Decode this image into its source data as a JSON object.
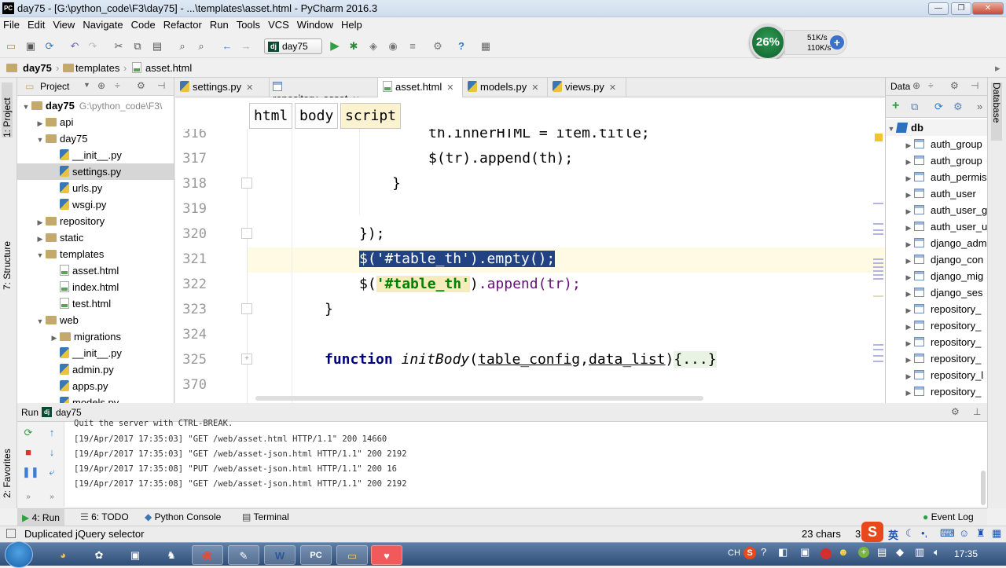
{
  "window": {
    "title": "day75 - [G:\\python_code\\F3\\day75] - ...\\templates\\asset.html - PyCharm 2016.3",
    "logo": "PC"
  },
  "menu": [
    "File",
    "Edit",
    "View",
    "Navigate",
    "Code",
    "Refactor",
    "Run",
    "Tools",
    "VCS",
    "Window",
    "Help"
  ],
  "toolbar": {
    "run_config": "day75"
  },
  "perf": {
    "cpu": "26%",
    "up": "51K/s",
    "down": "110K/s"
  },
  "breadcrumb": [
    "day75",
    "templates",
    "asset.html"
  ],
  "project_panel": {
    "title": "Project",
    "tree": [
      {
        "label": "day75",
        "extra": "G:\\python_code\\F3\\",
        "indent": 0,
        "kind": "folder",
        "arrow": "▼"
      },
      {
        "label": "api",
        "indent": 1,
        "kind": "folder",
        "arrow": "▶"
      },
      {
        "label": "day75",
        "indent": 1,
        "kind": "folder",
        "arrow": "▼"
      },
      {
        "label": "__init__.py",
        "indent": 2,
        "kind": "py",
        "arrow": ""
      },
      {
        "label": "settings.py",
        "indent": 2,
        "kind": "py",
        "arrow": "",
        "selected": true
      },
      {
        "label": "urls.py",
        "indent": 2,
        "kind": "py",
        "arrow": ""
      },
      {
        "label": "wsgi.py",
        "indent": 2,
        "kind": "py",
        "arrow": ""
      },
      {
        "label": "repository",
        "indent": 1,
        "kind": "folder",
        "arrow": "▶"
      },
      {
        "label": "static",
        "indent": 1,
        "kind": "folder",
        "arrow": "▶"
      },
      {
        "label": "templates",
        "indent": 1,
        "kind": "folder",
        "arrow": "▼"
      },
      {
        "label": "asset.html",
        "indent": 2,
        "kind": "html",
        "arrow": ""
      },
      {
        "label": "index.html",
        "indent": 2,
        "kind": "html",
        "arrow": ""
      },
      {
        "label": "test.html",
        "indent": 2,
        "kind": "html",
        "arrow": ""
      },
      {
        "label": "web",
        "indent": 1,
        "kind": "folder",
        "arrow": "▼"
      },
      {
        "label": "migrations",
        "indent": 2,
        "kind": "folder",
        "arrow": "▶"
      },
      {
        "label": "__init__.py",
        "indent": 2,
        "kind": "py",
        "arrow": ""
      },
      {
        "label": "admin.py",
        "indent": 2,
        "kind": "py",
        "arrow": ""
      },
      {
        "label": "apps.py",
        "indent": 2,
        "kind": "py",
        "arrow": ""
      },
      {
        "label": "models.py",
        "indent": 2,
        "kind": "py",
        "arrow": ""
      }
    ]
  },
  "editor_tabs": [
    {
      "label": "settings.py",
      "active": false
    },
    {
      "label": "repository_asset",
      "active": false
    },
    {
      "label": "asset.html",
      "active": true
    },
    {
      "label": "models.py",
      "active": false
    },
    {
      "label": "views.py",
      "active": false
    }
  ],
  "tag_crumbs": [
    "html",
    "body",
    "script"
  ],
  "lines": [
    "316",
    "317",
    "318",
    "319",
    "320",
    "321",
    "322",
    "323",
    "324",
    "325",
    "370"
  ],
  "code": {
    "l316": "th.innerHTML = item.title;",
    "l317": "$(tr).append(th);",
    "l318": "}",
    "l320": "});",
    "l321_sel": "$('#table_th').empty();",
    "l322_a": "$(",
    "l322_str": "'#table_th'",
    "l322_b": ")",
    "l322_c": ".append(tr);",
    "l323": "}",
    "l325_kw": "function",
    "l325_fn": "initBody",
    "l325_args_a": "table_config",
    "l325_args_b": "data_list",
    "l325_fold": "{...}"
  },
  "db_panel": {
    "title": "Data",
    "root": "db",
    "tables": [
      "auth_group",
      "auth_group",
      "auth_permis",
      "auth_user",
      "auth_user_g",
      "auth_user_u",
      "django_adm",
      "django_con",
      "django_mig",
      "django_ses",
      "repository_",
      "repository_",
      "repository_",
      "repository_",
      "repository_l",
      "repository_"
    ]
  },
  "right_strip": {
    "label": "Database"
  },
  "left_strip": {
    "project": "1: Project",
    "structure": "7: Structure",
    "favorites": "2: Favorites"
  },
  "run_panel": {
    "title": "Run",
    "config": "day75",
    "log": [
      "Quit the server with CTRL-BREAK.",
      "[19/Apr/2017 17:35:03] \"GET /web/asset.html HTTP/1.1\" 200 14660",
      "[19/Apr/2017 17:35:03] \"GET /web/asset-json.html HTTP/1.1\" 200 2192",
      "[19/Apr/2017 17:35:08] \"PUT /web/asset-json.html HTTP/1.1\" 200 16",
      "[19/Apr/2017 17:35:08] \"GET /web/asset-json.html HTTP/1.1\" 200 2192"
    ]
  },
  "tool_tabs": {
    "run": "4: Run",
    "todo": "6: TODO",
    "console": "Python Console",
    "terminal": "Terminal",
    "event_log": "Event Log"
  },
  "status": {
    "message": "Duplicated jQuery selector",
    "chars": "23 chars",
    "pos": "3"
  },
  "taskbar": {
    "clock": "17:35",
    "ime": "英",
    "lang": "CH"
  }
}
